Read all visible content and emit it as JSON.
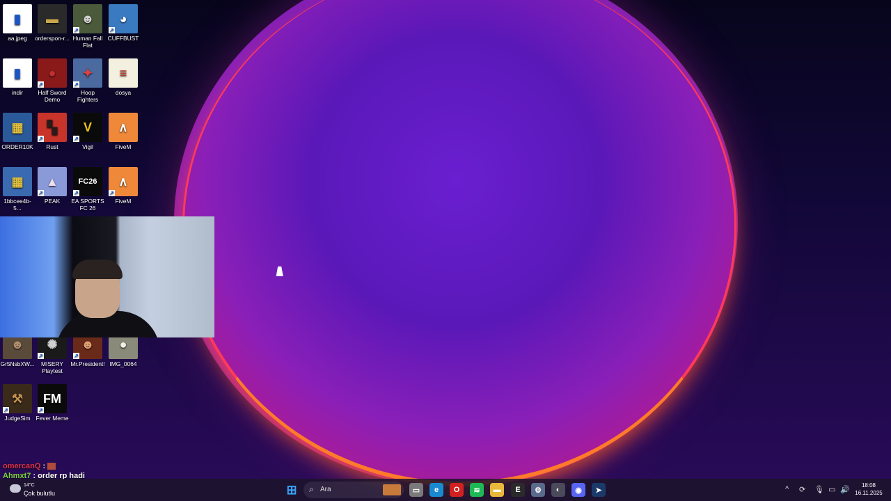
{
  "desktop": {
    "icons": [
      {
        "label": "aa.jpeg",
        "shortcut": false,
        "color": "#ffffff",
        "glyph": "▮",
        "glyph_color": "#1a55c8",
        "icon": "image-icon"
      },
      {
        "label": "orderspon-r...",
        "shortcut": false,
        "color": "#2a2a2a",
        "glyph": "▬",
        "glyph_color": "#c8a84a",
        "icon": "image-icon"
      },
      {
        "label": "Human Fall Flat",
        "shortcut": true,
        "color": "#4a5a3a",
        "glyph": "☻",
        "glyph_color": "#d0d0d0",
        "icon": "game-icon"
      },
      {
        "label": "CUFFBUST",
        "shortcut": true,
        "color": "#3a7ac0",
        "glyph": "◕",
        "glyph_color": "#ffffff",
        "icon": "game-icon"
      },
      {
        "label": "indir",
        "shortcut": false,
        "color": "#ffffff",
        "glyph": "▮",
        "glyph_color": "#1a55c8",
        "icon": "image-icon"
      },
      {
        "label": "Half Sword Demo",
        "shortcut": true,
        "color": "#8a1a1a",
        "glyph": "●",
        "glyph_color": "#c03030",
        "icon": "game-icon"
      },
      {
        "label": "Hoop Fighters",
        "shortcut": true,
        "color": "#4a6aa0",
        "glyph": "✦",
        "glyph_color": "#e04040",
        "icon": "game-icon"
      },
      {
        "label": "dosya",
        "shortcut": false,
        "color": "#f4f0e0",
        "glyph": "≡",
        "glyph_color": "#c03020",
        "icon": "document-icon"
      },
      {
        "label": "ORDER10K",
        "shortcut": false,
        "color": "#2a5a9a",
        "glyph": "▦",
        "glyph_color": "#e0c040",
        "icon": "image-icon"
      },
      {
        "label": "Rust",
        "shortcut": true,
        "color": "#c8342a",
        "glyph": "▚",
        "glyph_color": "#2a1a1a",
        "icon": "game-icon"
      },
      {
        "label": "Vigil",
        "shortcut": true,
        "color": "#0a0a0a",
        "glyph": "V",
        "glyph_color": "#e8c020",
        "icon": "game-icon"
      },
      {
        "label": "FiveM",
        "shortcut": false,
        "color": "#f0883a",
        "glyph": "∧",
        "glyph_color": "#ffffff",
        "icon": "game-icon"
      },
      {
        "label": "1bbcee4b-5...",
        "shortcut": false,
        "color": "#3a6ab0",
        "glyph": "▦",
        "glyph_color": "#e0c040",
        "icon": "image-icon"
      },
      {
        "label": "PEAK",
        "shortcut": true,
        "color": "#8a9ad8",
        "glyph": "▲",
        "glyph_color": "#f0e0f0",
        "icon": "game-icon"
      },
      {
        "label": "EA SPORTS FC 26",
        "shortcut": true,
        "color": "#0a0a0a",
        "glyph": "FC26",
        "glyph_color": "#ffffff",
        "icon": "game-icon"
      },
      {
        "label": "FiveM",
        "shortcut": true,
        "color": "#f0883a",
        "glyph": "∧",
        "glyph_color": "#ffffff",
        "icon": "game-icon"
      },
      {
        "label": "Gr5NsbXW...",
        "shortcut": false,
        "color": "#5a4a3a",
        "glyph": "☻",
        "glyph_color": "#b09070",
        "icon": "image-icon"
      },
      {
        "label": "MISERY Playtest",
        "shortcut": true,
        "color": "#1a1a1a",
        "glyph": "✺",
        "glyph_color": "#d0d0d0",
        "icon": "game-icon"
      },
      {
        "label": "Mr.President!",
        "shortcut": true,
        "color": "#6a2a1a",
        "glyph": "☻",
        "glyph_color": "#e0a070",
        "icon": "game-icon"
      },
      {
        "label": "IMG_0064",
        "shortcut": false,
        "color": "#8a8a7a",
        "glyph": "●",
        "glyph_color": "#f0f0e8",
        "icon": "image-icon"
      },
      {
        "label": "JudgeSim",
        "shortcut": true,
        "color": "#3a2a1a",
        "glyph": "⚒",
        "glyph_color": "#c09050",
        "icon": "game-icon"
      },
      {
        "label": "Fever Meme",
        "shortcut": true,
        "color": "#0a0a0a",
        "glyph": "FM",
        "glyph_color": "#ffffff",
        "icon": "game-icon"
      }
    ]
  },
  "chat": {
    "messages": [
      {
        "user": "omercanQ",
        "text": ""
      },
      {
        "user": "Ahmxt7",
        "text": "order rp hadi"
      }
    ]
  },
  "taskbar": {
    "weather": {
      "temp": "14°C",
      "desc": "Çok bulutlu"
    },
    "search_placeholder": "Ara",
    "apps": [
      {
        "name": "start-icon",
        "color": "#1e8ef0",
        "glyph": "⊞"
      },
      {
        "name": "widgets-icon",
        "color": "#c87a3a",
        "glyph": "▦"
      },
      {
        "name": "task-view-icon",
        "color": "#7a7a7a",
        "glyph": "▭"
      },
      {
        "name": "edge-icon",
        "color": "#1a8ad0",
        "glyph": "e"
      },
      {
        "name": "opera-icon",
        "color": "#d02020",
        "glyph": "O"
      },
      {
        "name": "spotify-icon",
        "color": "#1db954",
        "glyph": "≋"
      },
      {
        "name": "file-explorer-icon",
        "color": "#e8b83a",
        "glyph": "▬"
      },
      {
        "name": "epic-games-icon",
        "color": "#2a2a2a",
        "glyph": "E"
      },
      {
        "name": "settings-icon",
        "color": "#5a6a8a",
        "glyph": "⚙"
      },
      {
        "name": "steam-alt-icon",
        "color": "#4a4a5a",
        "glyph": "◐"
      },
      {
        "name": "discord-icon",
        "color": "#5865f2",
        "glyph": "◉"
      },
      {
        "name": "steam-icon",
        "color": "#1a3a6a",
        "glyph": "➤"
      }
    ],
    "tray": {
      "chevron": "^",
      "icons": [
        "sync-icon",
        "microphone-icon",
        "display-icon",
        "volume-icon"
      ]
    },
    "clock": {
      "time": "18:08",
      "date": "16.11.2025"
    }
  }
}
